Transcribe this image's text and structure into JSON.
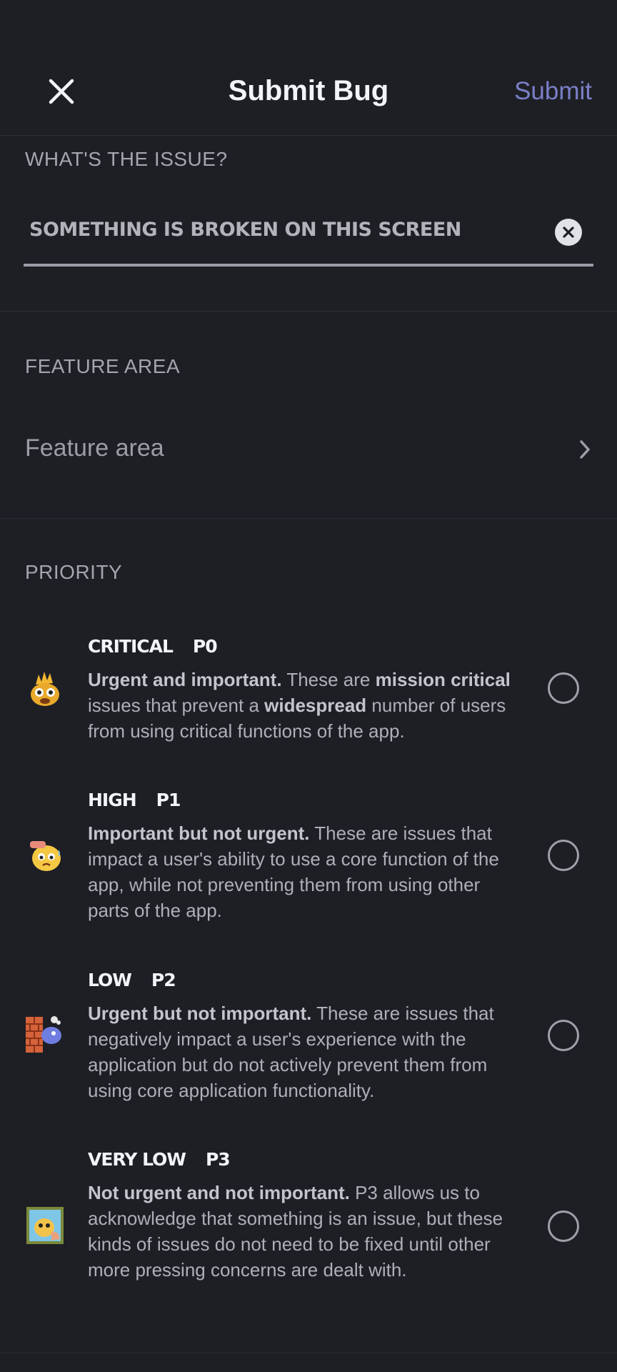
{
  "header": {
    "title": "Submit Bug",
    "submit_label": "Submit"
  },
  "issue": {
    "label": "WHAT'S THE ISSUE?",
    "value": "Something is broken on this screen"
  },
  "feature_area": {
    "label": "FEATURE AREA",
    "placeholder": "Feature area"
  },
  "priority": {
    "label": "PRIORITY",
    "items": [
      {
        "name": "Critical",
        "code": "P0",
        "lead": "Urgent and important.",
        "text1": " These are ",
        "bold1": "mission critical",
        "text2": " issues that prevent a ",
        "bold2": "widespread",
        "text3": " number of users from using critical functions of the app.",
        "icon": "fire-duck-icon",
        "selected": false
      },
      {
        "name": "High",
        "code": "P1",
        "lead": "Important but not urgent.",
        "text": " These are issues that impact a user's ability to use a core function of the app, while not preventing them from using other parts of the app.",
        "icon": "worried-face-icon",
        "selected": false
      },
      {
        "name": "Low",
        "code": "P2",
        "lead": "Urgent but not important.",
        "text": " These are issues that negatively impact a user's experience with the application but do not actively prevent them from using core application functionality.",
        "icon": "brick-wall-ghost-icon",
        "selected": false
      },
      {
        "name": "Very Low",
        "code": "P3",
        "lead": "Not urgent and not important.",
        "text": " P3 allows us to acknowledge that something is an issue, but these kinds of issues do not need to be fixed until other more pressing concerns are dealt with.",
        "icon": "framed-picture-icon",
        "selected": false
      }
    ]
  },
  "colors": {
    "background": "#1e1f25",
    "accent": "#7b7fc7",
    "divider": "#2d2e35"
  }
}
